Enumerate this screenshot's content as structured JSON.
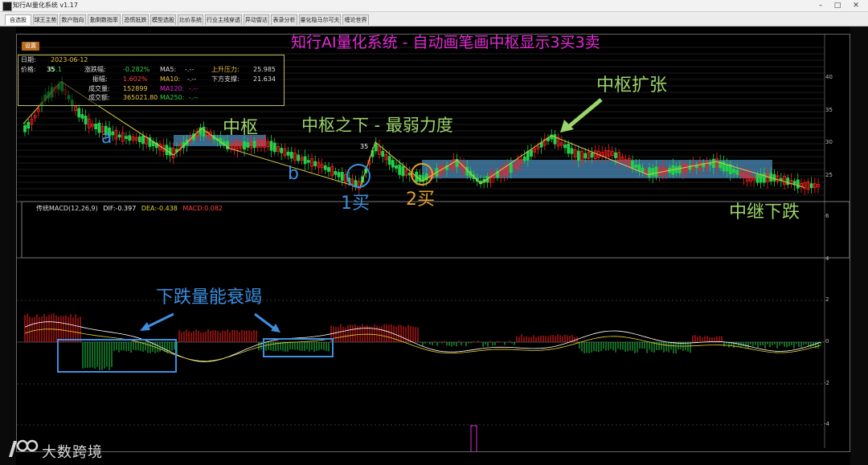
{
  "window": {
    "title": "知行AI量化系统 v1.17",
    "minimize_label": "–",
    "maximize_label": "□",
    "close_label": "✕"
  },
  "tabs": [
    "自选股",
    "球王主势",
    "数户指向",
    "勤剩数指率",
    "恐慌抵跌",
    "模型选股",
    "比价系统",
    "行业主线穿透",
    "异动雷达",
    "表录分析",
    "量化隐马尔可夫",
    "缠论世界"
  ],
  "toolbar": {
    "settings_label": "设置"
  },
  "headline": "知行AI量化系统 - 自动画笔画中枢显示3买3卖",
  "info_box": {
    "date_label": "日期:",
    "date_value": "2023-06-12",
    "price_label": "价格:",
    "price_value": "35.1",
    "change_pct_label": "涨跌幅:",
    "change_pct_value": "-0.282%",
    "amplitude_label": "振幅:",
    "amplitude_value": "1.602%",
    "volume_label": "成交量:",
    "volume_value": "152899",
    "turnover_label": "成交额:",
    "turnover_value": "365021.80",
    "ma5_label": "MA5:",
    "ma5_value": "-.--",
    "ma10_label": "MA10:",
    "ma10_value": "-.--",
    "ma120_label": "MA120:",
    "ma120_value": "-.--",
    "ma250_label": "MA250:",
    "ma250_value": "-.--",
    "resistance_label": "上升压力:",
    "resistance_value": "25.985",
    "support_label": "下方支撑:",
    "support_value": "21.634"
  },
  "price_axis": [
    "40",
    "35",
    "30",
    "25"
  ],
  "macd_axis": [
    "6",
    "4",
    "2",
    "0",
    "-2",
    "-4"
  ],
  "price_marks": [
    "35",
    "35"
  ],
  "macd_legend": {
    "name": "传统MACD(12,26,9)",
    "dif": "DIF:-0.397",
    "dea": "DEA:-0.438",
    "macd": "MACD:0.082"
  },
  "annotations": {
    "center_label": "中枢",
    "below_center": "中枢之下 - 最弱力度",
    "center_expand": "中枢扩张",
    "leg_a": "a",
    "leg_b": "b",
    "buy1": "1买",
    "buy2": "2买",
    "relay_down": "中继下跌",
    "volume_exhaust": "下跌量能衰竭"
  },
  "watermark": {
    "text": "大数跨境"
  },
  "colors": {
    "up_candle": "#ff2020",
    "down_candle": "#22d04a",
    "pivot_zone": "#4a8ab8",
    "headline": "#e22bd4",
    "annotation_green": "#9bd46a",
    "annotation_blue": "#3d8fe0",
    "annotation_orange": "#e0a030",
    "dif_line": "#ffffff",
    "dea_line": "#e8d030"
  }
}
